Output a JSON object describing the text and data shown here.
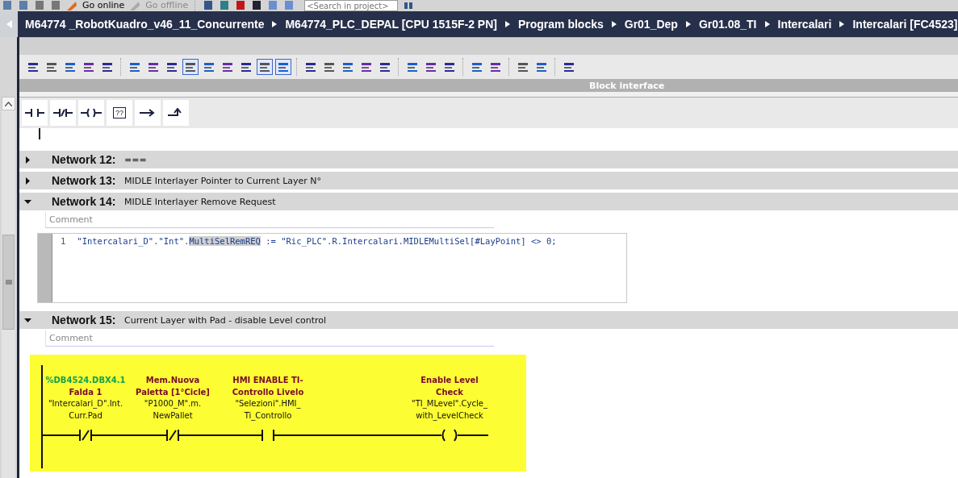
{
  "toolbar": {
    "go_online": "Go online",
    "go_offline": {
      "label": "Go offline",
      "disabled": true
    },
    "search": {
      "placeholder": "<Search in project>"
    }
  },
  "breadcrumb": [
    "M64774 _RobotKuadro_v46_11_Concurrente",
    "M64774_PLC_DEPAL [CPU 1515F-2 PN]",
    "Program blocks",
    "Gr01_Dep",
    "Gr01.08_TI",
    "Intercalari",
    "Intercalari [FC4523]"
  ],
  "panel": {
    "title": "Block interface"
  },
  "lad_elements": [
    {
      "kind": "no_contact"
    },
    {
      "kind": "nc_contact"
    },
    {
      "kind": "coil"
    },
    {
      "kind": "box",
      "label": "??"
    },
    {
      "kind": "branch_open"
    },
    {
      "kind": "branch_close"
    }
  ],
  "networks": [
    {
      "number": "Network 12:",
      "title": "===",
      "expanded": false
    },
    {
      "number": "Network 13:",
      "title": "MIDLE Interlayer Pointer to Current Layer N°",
      "expanded": false
    },
    {
      "number": "Network 14:",
      "title": "MIDLE Interlayer Remove Request",
      "expanded": true,
      "comment": "Comment",
      "kind": "scl",
      "code": {
        "line_number": "1",
        "before": "\"Intercalari_D\".\"Int\".",
        "highlight": "MultiSelRemREQ",
        "after": " := \"Ric_PLC\".R.Intercalari.MIDLEMultiSel[#LayPoint] <> 0;"
      }
    },
    {
      "number": "Network 15:",
      "title": "Current Layer with Pad - disable Level control",
      "expanded": true,
      "comment": "Comment",
      "kind": "lad",
      "rung": [
        {
          "kind": "nc_contact",
          "address": "%DB4524.DBX4.1",
          "symbol_comment": [
            "Falda 1"
          ],
          "operand": [
            "\"Intercalari_D\".Int.",
            "Curr.Pad"
          ]
        },
        {
          "kind": "nc_contact",
          "symbol_comment": [
            "Mem.Nuova",
            "Paletta  [1°Cicle]"
          ],
          "operand": [
            "\"P1000_M\".m.",
            "NewPallet"
          ]
        },
        {
          "kind": "no_contact",
          "symbol_comment": [
            "HMI ENABLE TI-",
            "Controllo Livelo"
          ],
          "operand": [
            "\"Selezioni\".HMI_",
            "Ti_Controllo"
          ]
        },
        {
          "kind": "coil",
          "symbol_comment": [
            "Enable Level",
            "Check"
          ],
          "operand": [
            "\"TI_MLevel\".Cycle_",
            "with_LevelCheck"
          ]
        }
      ]
    }
  ]
}
